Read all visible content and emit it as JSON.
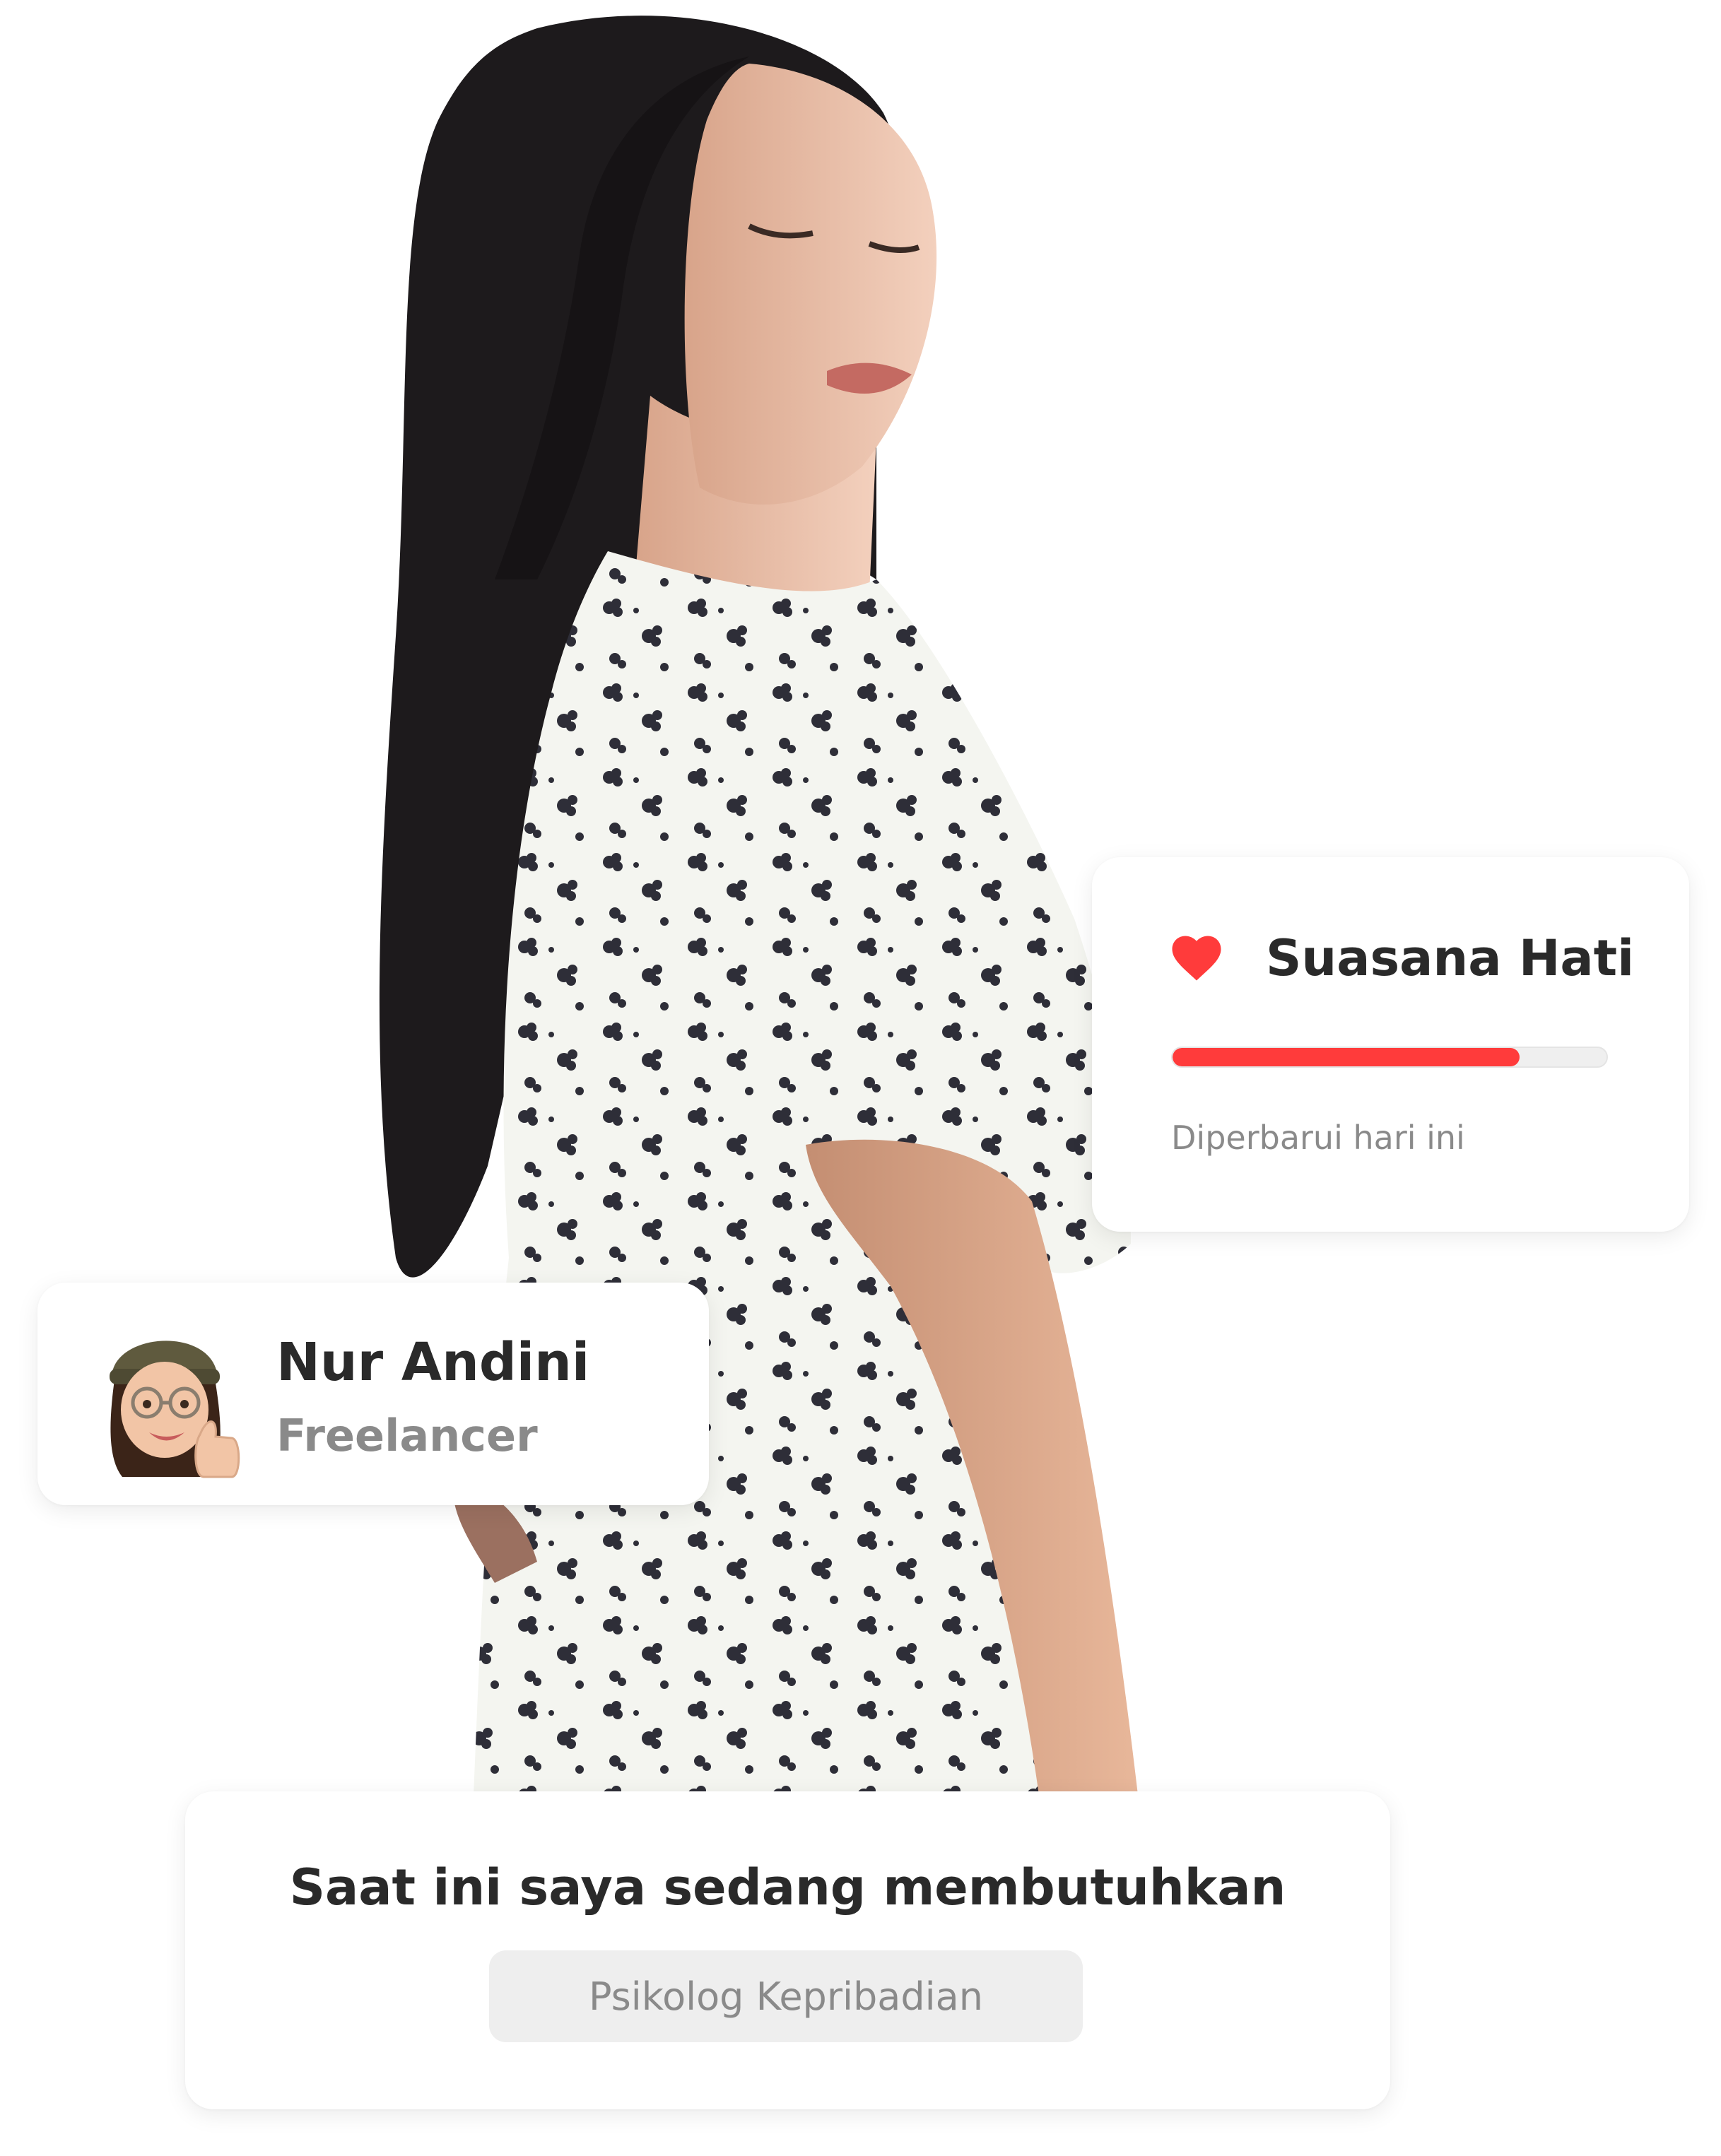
{
  "mood_card": {
    "title": "Suasana Hati",
    "progress": 0.8,
    "updated": "Diperbarui hari ini",
    "accent": "#ff3b3b",
    "icon": "heart-icon"
  },
  "profile_card": {
    "name": "Nur Andini",
    "role": "Freelancer",
    "avatar": "memoji-avatar"
  },
  "need_card": {
    "title": "Saat ini saya sedang membutuhkan",
    "option": "Psikolog Kepribadian"
  }
}
